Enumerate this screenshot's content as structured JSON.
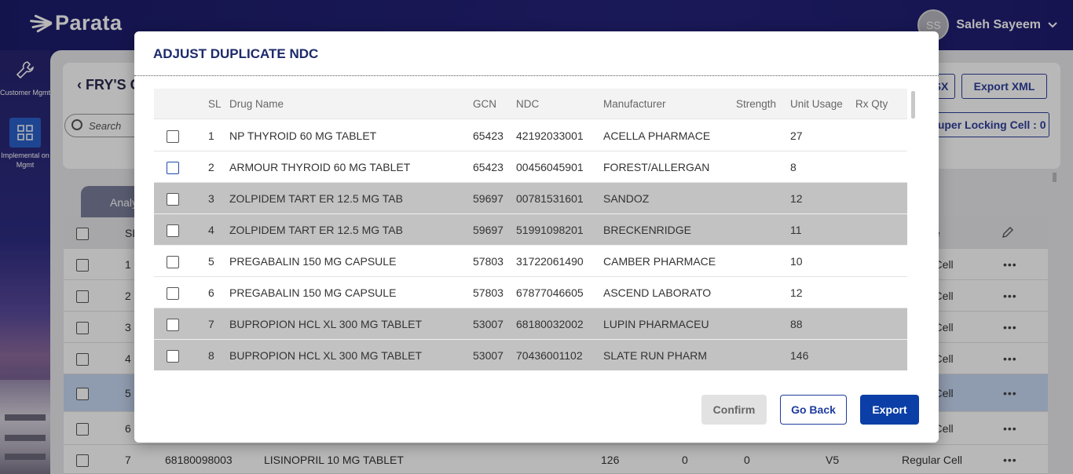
{
  "app": {
    "logo_text": "Parata",
    "user": {
      "initials": "SS",
      "name": "Saleh Sayeem"
    }
  },
  "sidebar": {
    "items": [
      {
        "label": "Customer Mgmt",
        "icon": "wrench-icon"
      },
      {
        "label": "Implemental on Mgmt",
        "icon": "grid-icon"
      }
    ]
  },
  "page": {
    "title_partial": "FRY'S C",
    "search_placeholder": "Search",
    "buttons": {
      "partial_x": "SX",
      "export_xml": "Export XML",
      "super_locking": "Super Locking Cell : 0"
    },
    "tab_partial": "Analy",
    "table": {
      "header_sl": "SL",
      "header_partial": "e",
      "rows": [
        {
          "sl": "1",
          "type": "r Cell"
        },
        {
          "sl": "2",
          "type": "r Cell"
        },
        {
          "sl": "3",
          "type": "r Cell"
        },
        {
          "sl": "4",
          "type": "r Cell"
        },
        {
          "sl": "5",
          "type": "r Cell"
        },
        {
          "sl": "6",
          "type": "r Cell"
        },
        {
          "sl": "7",
          "ndc": "68180098003",
          "drug": "LISINOPRIL 10 MG TABLET",
          "c1": "126",
          "c2": "0",
          "c3": "0",
          "c4": "V5",
          "type": "Regular Cell"
        }
      ]
    }
  },
  "modal": {
    "title": "ADJUST DUPLICATE NDC",
    "columns": {
      "sl": "SL",
      "drug_name": "Drug Name",
      "gcn": "GCN",
      "ndc": "NDC",
      "manufacturer": "Manufacturer",
      "strength": "Strength",
      "unit_usage": "Unit Usage",
      "rx_qty": "Rx Qty"
    },
    "rows": [
      {
        "sl": "1",
        "drug_name": "NP THYROID 60 MG TABLET",
        "gcn": "65423",
        "ndc": "42192033001",
        "manufacturer": "ACELLA PHARMACE",
        "strength": "",
        "unit_usage": "27",
        "rx_qty": "",
        "highlight": false
      },
      {
        "sl": "2",
        "drug_name": "ARMOUR THYROID 60 MG TABLET",
        "gcn": "65423",
        "ndc": "00456045901",
        "manufacturer": "FOREST/ALLERGAN",
        "strength": "",
        "unit_usage": "8",
        "rx_qty": "",
        "highlight": false
      },
      {
        "sl": "3",
        "drug_name": "ZOLPIDEM TART ER 12.5 MG TAB",
        "gcn": "59697",
        "ndc": "00781531601",
        "manufacturer": "SANDOZ",
        "strength": "",
        "unit_usage": "12",
        "rx_qty": "",
        "highlight": true
      },
      {
        "sl": "4",
        "drug_name": "ZOLPIDEM TART ER 12.5 MG TAB",
        "gcn": "59697",
        "ndc": "51991098201",
        "manufacturer": "BRECKENRIDGE",
        "strength": "",
        "unit_usage": "11",
        "rx_qty": "",
        "highlight": true
      },
      {
        "sl": "5",
        "drug_name": "PREGABALIN 150 MG CAPSULE",
        "gcn": "57803",
        "ndc": "31722061490",
        "manufacturer": "CAMBER PHARMACE",
        "strength": "",
        "unit_usage": "10",
        "rx_qty": "",
        "highlight": false
      },
      {
        "sl": "6",
        "drug_name": "PREGABALIN 150 MG CAPSULE",
        "gcn": "57803",
        "ndc": "67877046605",
        "manufacturer": "ASCEND LABORATO",
        "strength": "",
        "unit_usage": "12",
        "rx_qty": "",
        "highlight": false
      },
      {
        "sl": "7",
        "drug_name": "BUPROPION HCL XL 300 MG TABLET",
        "gcn": "53007",
        "ndc": "68180032002",
        "manufacturer": "LUPIN PHARMACEU",
        "strength": "",
        "unit_usage": "88",
        "rx_qty": "",
        "highlight": true
      },
      {
        "sl": "8",
        "drug_name": "BUPROPION HCL XL 300 MG TABLET",
        "gcn": "53007",
        "ndc": "70436001102",
        "manufacturer": "SLATE RUN PHARM",
        "strength": "",
        "unit_usage": "146",
        "rx_qty": "",
        "highlight": true
      }
    ],
    "buttons": {
      "confirm": "Confirm",
      "go_back": "Go Back",
      "export": "Export"
    }
  },
  "colors": {
    "navy": "#1c1c6b",
    "primary": "#0b3ea6",
    "row_highlight": "#c2c2c2",
    "selected_row": "#c6d7f1"
  }
}
